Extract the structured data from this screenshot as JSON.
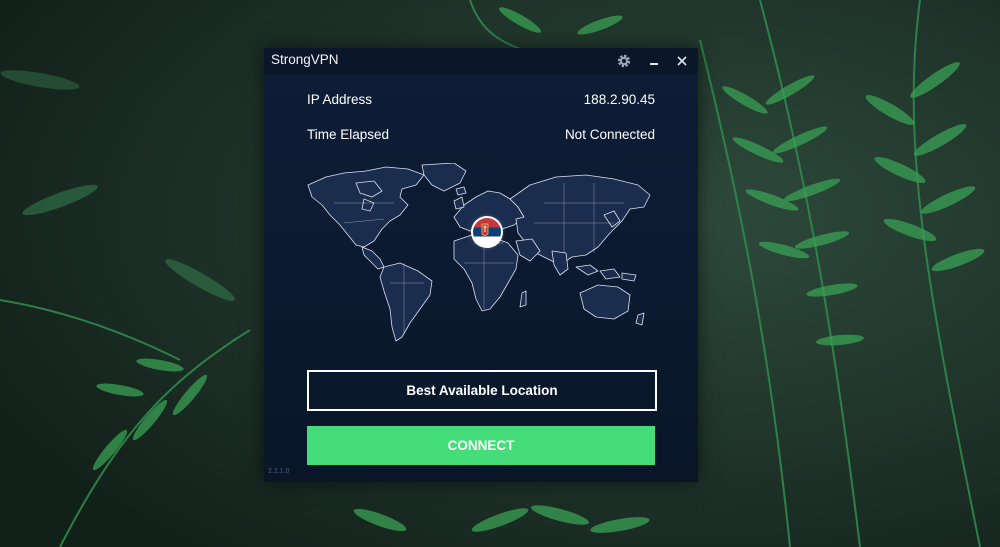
{
  "window": {
    "title": "StrongVPN",
    "version": "2.2.1.0"
  },
  "titlebar_icons": [
    "gear-icon",
    "minimize-icon",
    "close-icon"
  ],
  "status": {
    "ip_label": "IP Address",
    "ip_value": "188.2.90.45",
    "time_label": "Time Elapsed",
    "time_value": "Not Connected"
  },
  "map": {
    "flag_icon": "serbia-flag-icon"
  },
  "buttons": {
    "location_label": "Best Available Location",
    "connect_label": "CONNECT"
  },
  "colors": {
    "accent": "#45dd7a",
    "window_bg": "#0e1d36",
    "titlebar_bg": "#0b1628",
    "text": "#ffffff"
  }
}
